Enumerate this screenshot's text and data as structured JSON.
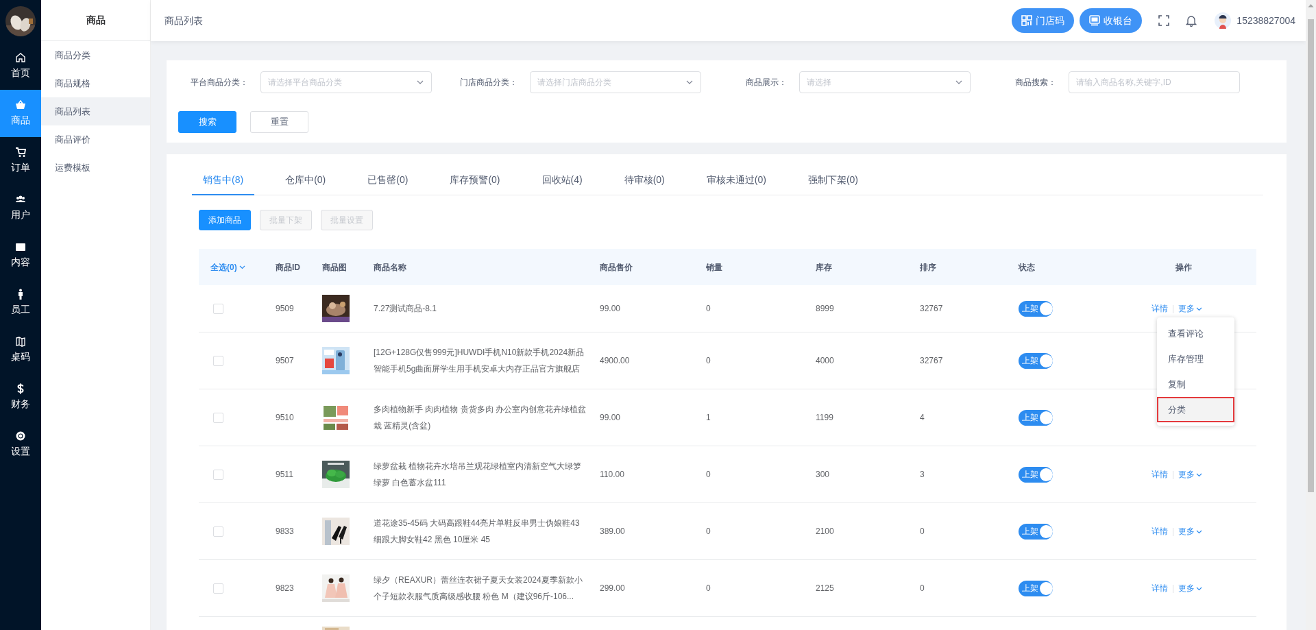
{
  "rail": {
    "items": [
      {
        "label": "首页",
        "kind": "home",
        "selected": false
      },
      {
        "label": "商品",
        "kind": "basket",
        "selected": true
      },
      {
        "label": "订单",
        "kind": "cart",
        "selected": false
      },
      {
        "label": "用户",
        "kind": "users",
        "selected": false
      },
      {
        "label": "内容",
        "kind": "box",
        "selected": false
      },
      {
        "label": "员工",
        "kind": "person",
        "selected": false
      },
      {
        "label": "桌码",
        "kind": "map",
        "selected": false
      },
      {
        "label": "财务",
        "kind": "dollar",
        "selected": false
      },
      {
        "label": "设置",
        "kind": "gear",
        "selected": false
      }
    ]
  },
  "submenu": {
    "title": "商品",
    "items": [
      {
        "label": "商品分类",
        "selected": false
      },
      {
        "label": "商品规格",
        "selected": false
      },
      {
        "label": "商品列表",
        "selected": true
      },
      {
        "label": "商品评价",
        "selected": false
      },
      {
        "label": "运费模板",
        "selected": false
      }
    ]
  },
  "header": {
    "title": "商品列表",
    "buttons": [
      {
        "label": "门店码",
        "kind": "qr"
      },
      {
        "label": "收银台",
        "kind": "cashier"
      }
    ],
    "user": "15238827004"
  },
  "filters": {
    "fields": [
      {
        "label": "平台商品分类：",
        "placeholder": "请选择平台商品分类",
        "kind": "select"
      },
      {
        "label": "门店商品分类：",
        "placeholder": "请选择门店商品分类",
        "kind": "select"
      },
      {
        "label": "商品展示：",
        "placeholder": "请选择",
        "kind": "select"
      },
      {
        "label": "商品搜索：",
        "placeholder": "请输入商品名称,关键字,ID",
        "kind": "input"
      }
    ],
    "buttons": [
      {
        "label": "搜索",
        "kind": "primary"
      },
      {
        "label": "重置",
        "kind": "default"
      }
    ]
  },
  "tabs": [
    {
      "label": "销售中(8)",
      "selected": true
    },
    {
      "label": "仓库中(0)",
      "selected": false
    },
    {
      "label": "已售罄(0)",
      "selected": false
    },
    {
      "label": "库存预警(0)",
      "selected": false
    },
    {
      "label": "回收站(4)",
      "selected": false
    },
    {
      "label": "待审核(0)",
      "selected": false
    },
    {
      "label": "审核未通过(0)",
      "selected": false
    },
    {
      "label": "强制下架(0)",
      "selected": false
    }
  ],
  "actions": [
    {
      "label": "添加商品",
      "disabled": false
    },
    {
      "label": "批量下架",
      "disabled": true
    },
    {
      "label": "批量设置",
      "disabled": true
    }
  ],
  "table": {
    "select_all": "全选(0)",
    "columns": [
      "商品ID",
      "商品图",
      "商品名称",
      "商品售价",
      "销量",
      "库存",
      "排序",
      "状态",
      "操作"
    ],
    "rows": [
      {
        "checked": false,
        "id": "9509",
        "name": "7.27测试商品-8.1",
        "price": "99.00",
        "sales": "0",
        "stock": "8999",
        "sort": "32767",
        "status": {
          "label": "上架",
          "on": true
        },
        "actions": [
          "详情",
          "更多"
        ]
      },
      {
        "checked": false,
        "id": "9507",
        "name": "[12G+128G仅售999元]HUWDI手机N10新款手机2024新品智能手机5g曲面屏学生用手机安卓大内存正品官方旗舰店",
        "price": "4900.00",
        "sales": "0",
        "stock": "4000",
        "sort": "32767",
        "status": {
          "label": "上架",
          "on": true
        }
      },
      {
        "checked": false,
        "id": "9510",
        "name": "多肉植物新手 肉肉植物 贵货多肉 办公室内创意花卉绿植盆栽 蓝精灵(含盆)",
        "price": "99.00",
        "sales": "1",
        "stock": "1199",
        "sort": "4",
        "status": {
          "label": "上架",
          "on": true
        }
      },
      {
        "checked": false,
        "id": "9511",
        "name": "绿萝盆栽 植物花卉水培吊兰观花绿植室内清新空气大绿箩绿萝 白色蓄水盆111",
        "price": "110.00",
        "sales": "0",
        "stock": "300",
        "sort": "3",
        "status": {
          "label": "上架",
          "on": true
        },
        "actions": [
          "详情",
          "更多"
        ]
      },
      {
        "checked": false,
        "id": "9833",
        "name": "道花途35-45码 大码高跟鞋44亮片单鞋反串男士伪娘鞋43细跟大脚女鞋42 黑色 10厘米 45",
        "price": "389.00",
        "sales": "0",
        "stock": "2100",
        "sort": "0",
        "status": {
          "label": "上架",
          "on": true
        },
        "actions": [
          "详情",
          "更多"
        ]
      },
      {
        "checked": false,
        "id": "9823",
        "name": "绿夕（REAXUR）蕾丝连衣裙子夏天女装2024夏季新款小个子短款衣服气质高级感收腰 粉色 M（建议96斤-106...",
        "price": "299.00",
        "sales": "0",
        "stock": "2125",
        "sort": "0",
        "status": {
          "label": "上架",
          "on": true
        },
        "actions": [
          "详情",
          "更多"
        ]
      }
    ]
  },
  "more_menu": {
    "items": [
      {
        "label": "查看评论",
        "highlighted": false
      },
      {
        "label": "库存管理",
        "highlighted": false
      },
      {
        "label": "复制",
        "highlighted": false
      },
      {
        "label": "分类",
        "highlighted": true
      }
    ]
  }
}
